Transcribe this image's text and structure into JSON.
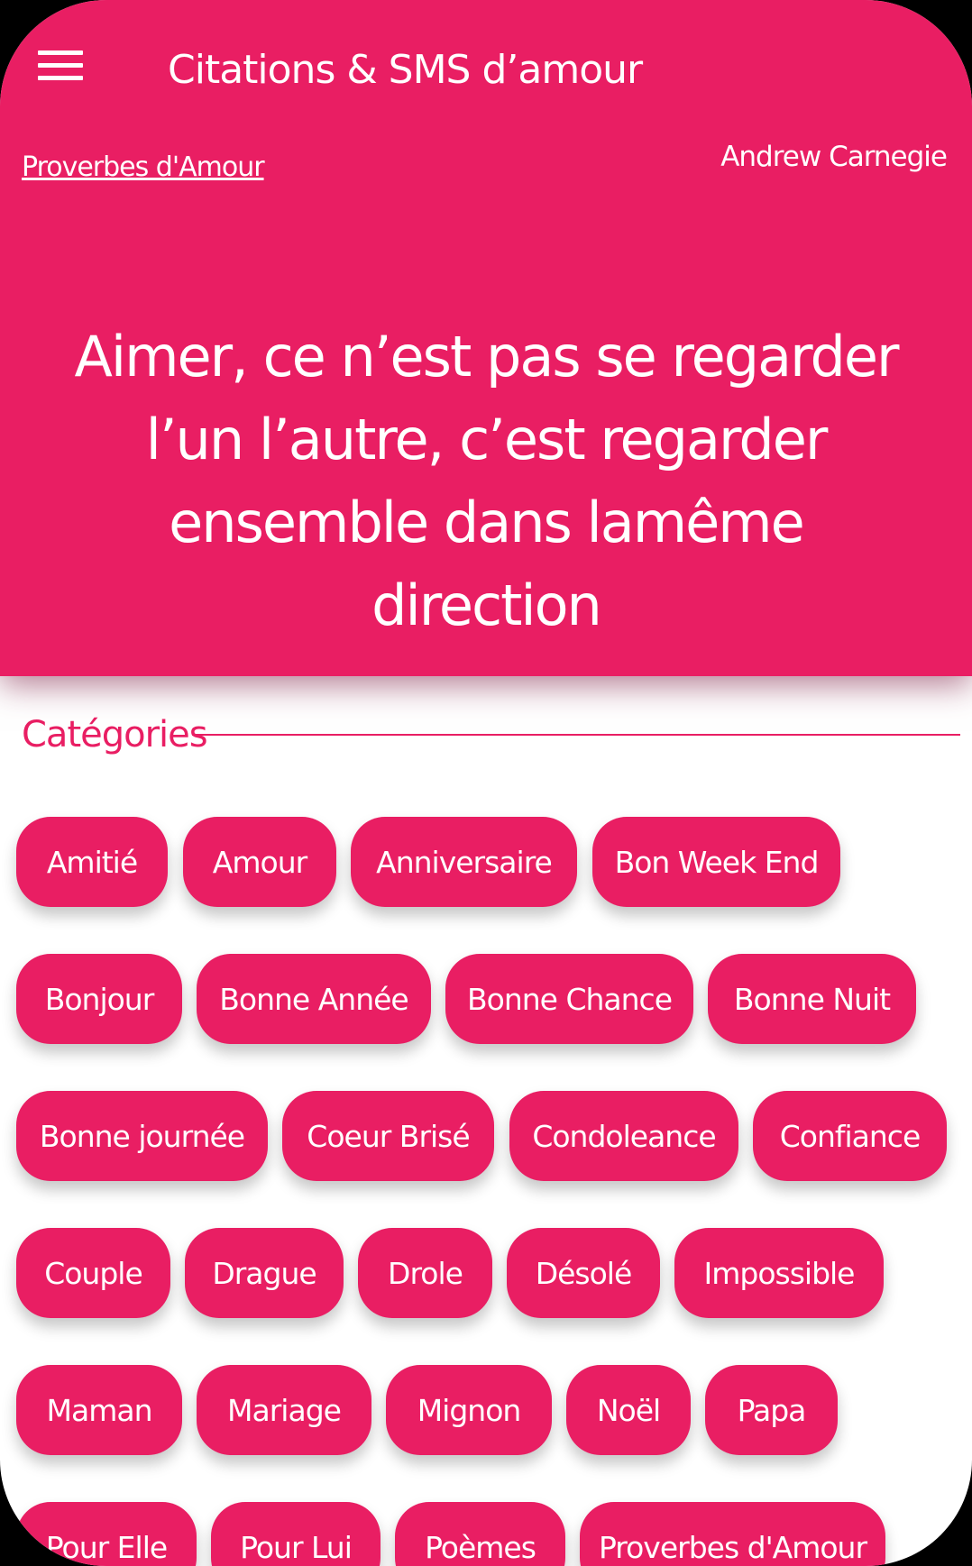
{
  "app_title": "Citations & SMS d’amour",
  "quote_card": {
    "category_link": "Proverbes d'Amour",
    "author": "Andrew Carnegie",
    "quote_text": "Aimer, ce n’est pas se regarder l’un l’autre, c’est regarder ensemble dans lamême direction"
  },
  "categories": {
    "title": "Catégories",
    "items": [
      "Amitié",
      "Amour",
      "Anniversaire",
      "Bon Week End",
      "Bonjour",
      "Bonne Année",
      "Bonne Chance",
      "Bonne Nuit",
      "Bonne journée",
      "Coeur Brisé",
      "Condoleance",
      "Confiance",
      "Couple",
      "Drague",
      "Drole",
      "Désolé",
      "Impossible",
      "Maman",
      "Mariage",
      "Mignon",
      "Noël",
      "Papa",
      "Pour Elle",
      "Pour Lui",
      "Poèmes",
      "Proverbes d'Amour"
    ]
  },
  "colors": {
    "accent": "#e91e63",
    "background": "#ffffff",
    "text_on_accent": "#ffffff"
  },
  "icons": {
    "menu": "hamburger-menu-icon"
  }
}
